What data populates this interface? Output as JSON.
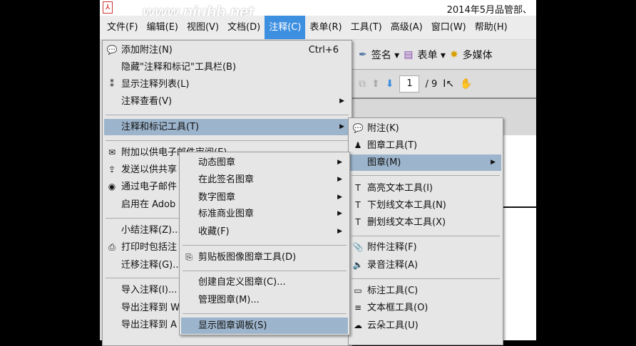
{
  "title": "2014年5月品管部、",
  "watermark": "www.niubb.net",
  "menubar": [
    "文件(F)",
    "编辑(E)",
    "视图(V)",
    "文档(D)",
    "注释(C)",
    "表单(R)",
    "工具(T)",
    "高级(A)",
    "窗口(W)",
    "帮助(H)"
  ],
  "toolbar": {
    "sign": "签名 ▾",
    "forms": "表单 ▾",
    "multimedia": "多媒体",
    "page": "1",
    "page_total": "/ 9"
  },
  "comments_menu": [
    {
      "label": "添加附注(N)",
      "shortcut": "Ctrl+6",
      "icon": "💬"
    },
    {
      "label": "隐藏\"注释和标记\"工具栏(B)"
    },
    {
      "label": "显示注释列表(L)",
      "icon": "⁑"
    },
    {
      "label": "注释查看(V)",
      "arrow": "▶"
    },
    {
      "label": "注释和标记工具(T)",
      "arrow": "▶"
    },
    {
      "label": "附加以供电子邮件审阅(E)",
      "icon": "✉"
    },
    {
      "label": "发送以供共享",
      "icon": "⇪"
    },
    {
      "label": "通过电子邮件",
      "icon": "◉"
    },
    {
      "label": "启用在 Adob"
    },
    {
      "label": "小结注释(Z)..."
    },
    {
      "label": "打印时包括注",
      "icon": "⎙"
    },
    {
      "label": "迁移注释(G)..."
    },
    {
      "label": "导入注释(I)..."
    },
    {
      "label": "导出注释到 W"
    },
    {
      "label": "导出注释到 A"
    }
  ],
  "stamp_menu": [
    {
      "label": "动态图章",
      "arrow": "▶"
    },
    {
      "label": "在此签名图章",
      "arrow": "▶"
    },
    {
      "label": "数字图章",
      "arrow": "▶"
    },
    {
      "label": "标准商业图章",
      "arrow": "▶"
    },
    {
      "label": "收藏(F)",
      "arrow": "▶"
    },
    {
      "label": "剪贴板图像图章工具(D)",
      "icon": "⎘"
    },
    {
      "label": "创建自定义图章(C)..."
    },
    {
      "label": "管理图章(M)..."
    },
    {
      "label": "显示图章调板(S)"
    }
  ],
  "markup_menu": [
    {
      "label": "附注(K)",
      "icon": "💬"
    },
    {
      "label": "图章工具(T)",
      "icon": "♟"
    },
    {
      "label": "图章(M)",
      "arrow": "▶"
    },
    {
      "label": "高亮文本工具(I)",
      "icon": "T"
    },
    {
      "label": "下划线文本工具(N)",
      "icon": "T"
    },
    {
      "label": "删划线文本工具(X)",
      "icon": "T"
    },
    {
      "label": "附件注释(F)",
      "icon": "📎"
    },
    {
      "label": "录音注释(A)",
      "icon": "🔈"
    },
    {
      "label": "标注工具(C)",
      "icon": "▭"
    },
    {
      "label": "文本框工具(O)",
      "icon": "≡"
    },
    {
      "label": "云朵工具(U)",
      "icon": "☁"
    }
  ]
}
